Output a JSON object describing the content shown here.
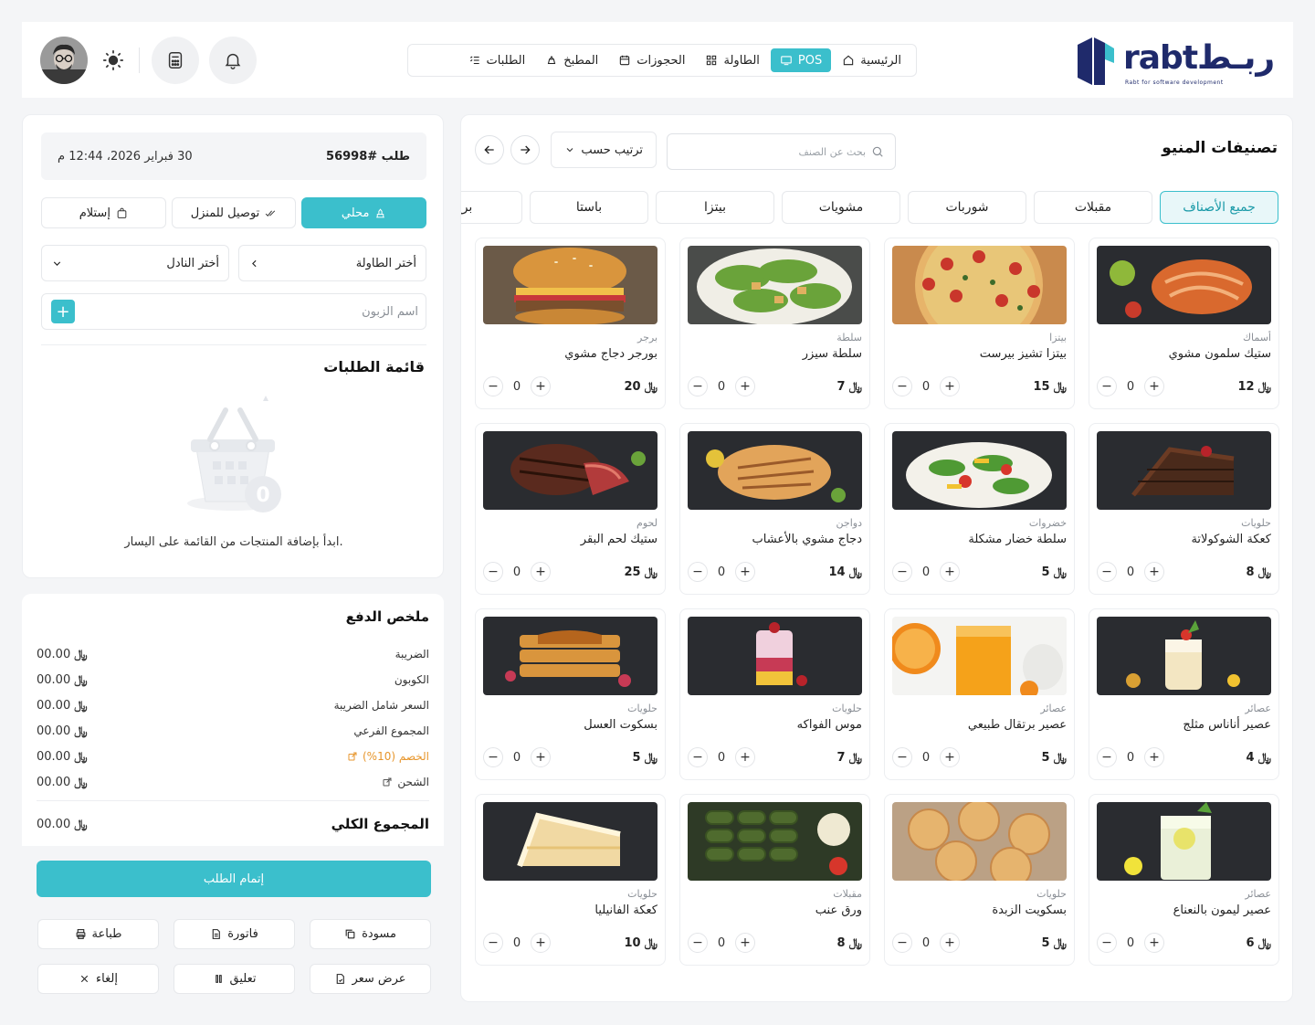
{
  "brand": {
    "word": "rabtربـط",
    "tagline": "Rabt for software development"
  },
  "nav": [
    {
      "label": "الرئيسية",
      "icon": "home-icon"
    },
    {
      "label": "POS",
      "icon": "monitor-icon",
      "active": true
    },
    {
      "label": "الطاولة",
      "icon": "grid-icon"
    },
    {
      "label": "الحجوزات",
      "icon": "calendar-icon"
    },
    {
      "label": "المطبخ",
      "icon": "chef-hat-icon"
    },
    {
      "label": "الطلبات",
      "icon": "list-icon"
    }
  ],
  "menu": {
    "title": "تصنيفات المنيو",
    "search_placeholder": "بحث عن الصنف",
    "sort_label": "ترتيب حسب",
    "categories": [
      "جميع الأصناف",
      "مقبلات",
      "شوربات",
      "مشويات",
      "بيتزا",
      "باستا",
      "برج"
    ],
    "currency_symbol": "﷼",
    "items": [
      {
        "category": "أسماك",
        "name": "ستيك سلمون مشوي",
        "price": "12",
        "qty": "0",
        "art": "salmon"
      },
      {
        "category": "بيتزا",
        "name": "بيتزا تشيز بيرست",
        "price": "15",
        "qty": "0",
        "art": "pizza"
      },
      {
        "category": "سلطة",
        "name": "سلطة سيزر",
        "price": "7",
        "qty": "0",
        "art": "caesar"
      },
      {
        "category": "برجر",
        "name": "بورجر دجاج مشوي",
        "price": "20",
        "qty": "0",
        "art": "burger"
      },
      {
        "category": "حلويات",
        "name": "كعكة الشوكولاتة",
        "price": "8",
        "qty": "0",
        "art": "chocolate"
      },
      {
        "category": "خضروات",
        "name": "سلطة خضار مشكلة",
        "price": "5",
        "qty": "0",
        "art": "veggies"
      },
      {
        "category": "دواجن",
        "name": "دجاج مشوي بالأعشاب",
        "price": "14",
        "qty": "0",
        "art": "chicken"
      },
      {
        "category": "لحوم",
        "name": "ستيك لحم البقر",
        "price": "25",
        "qty": "0",
        "art": "steak"
      },
      {
        "category": "عصائر",
        "name": "عصير أناناس مثلج",
        "price": "4",
        "qty": "0",
        "art": "pineapple"
      },
      {
        "category": "عصائر",
        "name": "عصير برتقال طبيعي",
        "price": "5",
        "qty": "0",
        "art": "orange"
      },
      {
        "category": "حلويات",
        "name": "موس الفواكه",
        "price": "7",
        "qty": "0",
        "art": "mousse"
      },
      {
        "category": "حلويات",
        "name": "بسكوت العسل",
        "price": "5",
        "qty": "0",
        "art": "honey"
      },
      {
        "category": "عصائر",
        "name": "عصير ليمون بالنعناع",
        "price": "6",
        "qty": "0",
        "art": "lemon"
      },
      {
        "category": "حلويات",
        "name": "بسكويت الزبدة",
        "price": "5",
        "qty": "0",
        "art": "butter"
      },
      {
        "category": "مقبلات",
        "name": "ورق عنب",
        "price": "8",
        "qty": "0",
        "art": "grape"
      },
      {
        "category": "حلويات",
        "name": "كعكة الفانيليا",
        "price": "10",
        "qty": "0",
        "art": "vanilla"
      }
    ]
  },
  "order": {
    "number": "طلب #56998",
    "date": "30 فبراير 2026، 12:44 م",
    "types": [
      {
        "label": "محلي",
        "active": true
      },
      {
        "label": "توصيل للمنزل"
      },
      {
        "label": "إستلام"
      }
    ],
    "table_select": "أختر الطاولة",
    "waiter_select": "أختر النادل",
    "customer_placeholder": "اسم الزبون",
    "list_title": "قائمة الطلبات",
    "empty_text": "ابدأ بإضافة المنتجات من القائمة على اليسار."
  },
  "payment": {
    "title": "ملخص الدفع",
    "rows": [
      {
        "label": "الضريبة",
        "value": "00.00"
      },
      {
        "label": "الكوبون",
        "value": "00.00"
      },
      {
        "label": "السعر شامل الضريبة",
        "value": "00.00"
      },
      {
        "label": "المجموع الفرعي",
        "value": "00.00"
      },
      {
        "label": "الخصم (10%)",
        "value": "00.00",
        "editable": true,
        "orange": true
      },
      {
        "label": "الشحن",
        "value": "00.00",
        "editable": true
      }
    ],
    "total_label": "المجموع الكلي",
    "total_value": "00.00",
    "complete_label": "إتمام الطلب",
    "actions": [
      {
        "label": "مسودة",
        "icon": "copy-icon"
      },
      {
        "label": "فاتورة",
        "icon": "invoice-icon"
      },
      {
        "label": "طباعة",
        "icon": "printer-icon"
      },
      {
        "label": "عرض سعر",
        "icon": "quote-icon"
      },
      {
        "label": "تعليق",
        "icon": "pause-icon"
      },
      {
        "label": "إلغاء",
        "icon": "close-icon"
      }
    ]
  },
  "colors": {
    "accent": "#3bbfcc",
    "brand": "#1f2a6b",
    "discount": "#e7962c"
  }
}
